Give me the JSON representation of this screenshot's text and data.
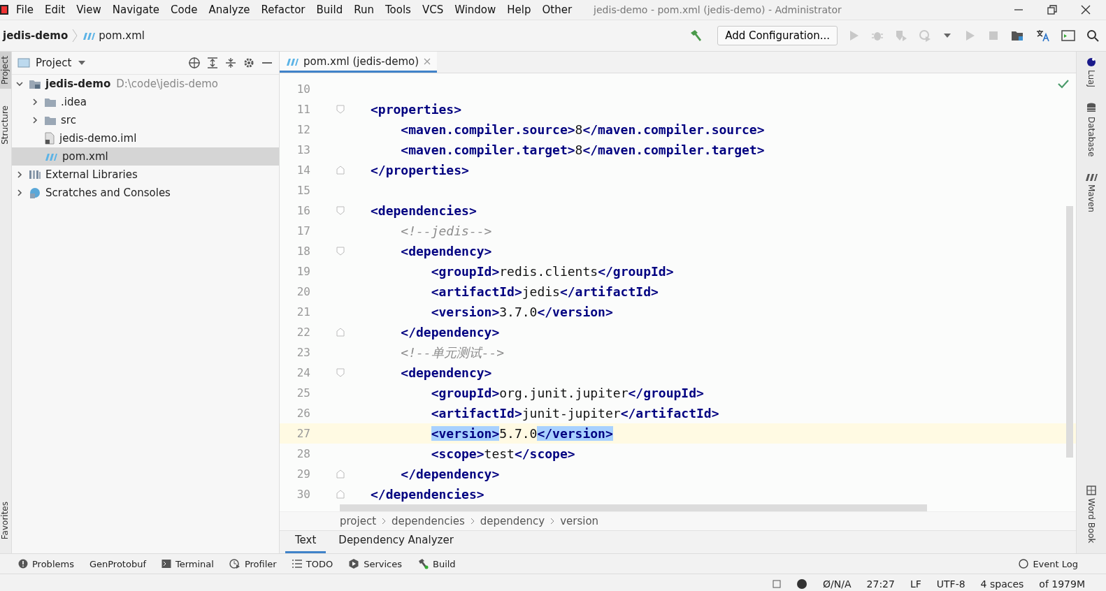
{
  "menu": [
    "File",
    "Edit",
    "View",
    "Navigate",
    "Code",
    "Analyze",
    "Refactor",
    "Build",
    "Run",
    "Tools",
    "VCS",
    "Window",
    "Help",
    "Other"
  ],
  "window": {
    "title": "jedis-demo - pom.xml (jedis-demo) - Administrator"
  },
  "nav_bar": {
    "project": "jedis-demo",
    "file": "pom.xml",
    "run_config": "Add Configuration..."
  },
  "left_strip": [
    "Project",
    "Structure",
    "Favorites"
  ],
  "right_strip": [
    "LuaJ",
    "Database",
    "Maven",
    "Word Book"
  ],
  "project_panel": {
    "title": "Project",
    "tree": [
      {
        "kind": "module",
        "label": "jedis-demo",
        "path": "D:\\code\\jedis-demo",
        "expanded": true,
        "selected": false,
        "children": [
          {
            "kind": "folder",
            "label": ".idea",
            "expanded": false,
            "selected": false
          },
          {
            "kind": "folder",
            "label": "src",
            "expanded": false,
            "selected": false
          },
          {
            "kind": "iml",
            "label": "jedis-demo.iml",
            "selected": false
          },
          {
            "kind": "maven",
            "label": "pom.xml",
            "selected": true
          }
        ]
      },
      {
        "kind": "library",
        "label": "External Libraries",
        "expanded": false,
        "selected": false
      },
      {
        "kind": "scratch",
        "label": "Scratches and Consoles",
        "expanded": false,
        "selected": false
      }
    ]
  },
  "editor": {
    "tabs": [
      {
        "label": "pom.xml (jedis-demo)",
        "selected": true
      }
    ],
    "lines": [
      {
        "number": "10",
        "current": false
      },
      {
        "number": "11",
        "current": false,
        "fold_start": true,
        "tokens": [
          {
            "kind": "tag",
            "s": "<properties>",
            "selected": false
          }
        ],
        "children": [
          {
            "number": "12",
            "current": false,
            "tokens": [
              {
                "kind": "tag",
                "s": "<maven.compiler.source>",
                "selected": false
              },
              {
                "kind": "text",
                "s": "8",
                "selected": false
              },
              {
                "kind": "tag",
                "s": "</maven.compiler.source>",
                "selected": false
              }
            ]
          },
          {
            "number": "13",
            "current": false,
            "tokens": [
              {
                "kind": "tag",
                "s": "<maven.compiler.target>",
                "selected": false
              },
              {
                "kind": "text",
                "s": "8",
                "selected": false
              },
              {
                "kind": "tag",
                "s": "</maven.compiler.target>",
                "selected": false
              }
            ]
          }
        ]
      },
      {
        "number": "14",
        "current": false,
        "fold_end": true,
        "tokens": [
          {
            "kind": "tag",
            "s": "</properties>",
            "selected": false
          }
        ]
      },
      {
        "number": "15",
        "current": false
      },
      {
        "number": "16",
        "current": false,
        "fold_start": true,
        "tokens": [
          {
            "kind": "tag",
            "s": "<dependencies>",
            "selected": false
          }
        ],
        "children": [
          {
            "number": "17",
            "current": false,
            "tokens": [
              {
                "kind": "comment",
                "s": "<!--jedis-->",
                "selected": false
              }
            ]
          },
          {
            "number": "18",
            "current": false,
            "fold_start": true,
            "tokens": [
              {
                "kind": "tag",
                "s": "<dependency>",
                "selected": false
              }
            ],
            "children": [
              {
                "number": "19",
                "current": false,
                "tokens": [
                  {
                    "kind": "tag",
                    "s": "<groupId>",
                    "selected": false
                  },
                  {
                    "kind": "text",
                    "s": "redis.clients",
                    "selected": false
                  },
                  {
                    "kind": "tag",
                    "s": "</groupId>",
                    "selected": false
                  }
                ]
              },
              {
                "number": "20",
                "current": false,
                "tokens": [
                  {
                    "kind": "tag",
                    "s": "<artifactId>",
                    "selected": false
                  },
                  {
                    "kind": "text",
                    "s": "jedis",
                    "selected": false
                  },
                  {
                    "kind": "tag",
                    "s": "</artifactId>",
                    "selected": false
                  }
                ]
              },
              {
                "number": "21",
                "current": false,
                "tokens": [
                  {
                    "kind": "tag",
                    "s": "<version>",
                    "selected": false
                  },
                  {
                    "kind": "text",
                    "s": "3.7.0",
                    "selected": false
                  },
                  {
                    "kind": "tag",
                    "s": "</version>",
                    "selected": false
                  }
                ]
              }
            ]
          },
          {
            "number": "22",
            "current": false,
            "fold_end": true,
            "tokens": [
              {
                "kind": "tag",
                "s": "</dependency>",
                "selected": false
              }
            ]
          },
          {
            "number": "23",
            "current": false,
            "tokens": [
              {
                "kind": "comment",
                "s": "<!--单元测试-->",
                "selected": false
              }
            ]
          },
          {
            "number": "24",
            "current": false,
            "fold_start": true,
            "tokens": [
              {
                "kind": "tag",
                "s": "<dependency>",
                "selected": false
              }
            ],
            "children": [
              {
                "number": "25",
                "current": false,
                "tokens": [
                  {
                    "kind": "tag",
                    "s": "<groupId>",
                    "selected": false
                  },
                  {
                    "kind": "text",
                    "s": "org.junit.jupiter",
                    "selected": false
                  },
                  {
                    "kind": "tag",
                    "s": "</groupId>",
                    "selected": false
                  }
                ]
              },
              {
                "number": "26",
                "current": false,
                "tokens": [
                  {
                    "kind": "tag",
                    "s": "<artifactId>",
                    "selected": false
                  },
                  {
                    "kind": "text",
                    "s": "junit-jupiter",
                    "selected": false
                  },
                  {
                    "kind": "tag",
                    "s": "</artifactId>",
                    "selected": false
                  }
                ]
              },
              {
                "number": "27",
                "current": true,
                "tokens": [
                  {
                    "kind": "tag",
                    "s": "<version>",
                    "selected": true
                  },
                  {
                    "kind": "text",
                    "s": "5.7.0",
                    "selected": false
                  },
                  {
                    "kind": "tag",
                    "s": "</version>",
                    "selected": true
                  }
                ]
              },
              {
                "number": "28",
                "current": false,
                "tokens": [
                  {
                    "kind": "tag",
                    "s": "<scope>",
                    "selected": false
                  },
                  {
                    "kind": "text",
                    "s": "test",
                    "selected": false
                  },
                  {
                    "kind": "tag",
                    "s": "</scope>",
                    "selected": false
                  }
                ]
              }
            ]
          },
          {
            "number": "29",
            "current": false,
            "fold_end": true,
            "tokens": [
              {
                "kind": "tag",
                "s": "</dependency>",
                "selected": false
              }
            ]
          }
        ]
      },
      {
        "number": "30",
        "current": false,
        "fold_end": true,
        "tokens": [
          {
            "kind": "tag",
            "s": "</dependencies>",
            "selected": false
          }
        ]
      }
    ],
    "breadcrumbs": [
      "project",
      "dependencies",
      "dependency",
      "version"
    ],
    "bottom_tabs": [
      {
        "label": "Text",
        "selected": true
      },
      {
        "label": "Dependency Analyzer",
        "selected": false
      }
    ]
  },
  "tool_windows": [
    "Problems",
    "GenProtobuf",
    "Terminal",
    "Profiler",
    "TODO",
    "Services",
    "Build"
  ],
  "event_log": "Event Log",
  "status_bar": [
    "Ø/N/A",
    "27:27",
    "LF",
    "UTF-8",
    "4 spaces",
    "of 1979M"
  ]
}
